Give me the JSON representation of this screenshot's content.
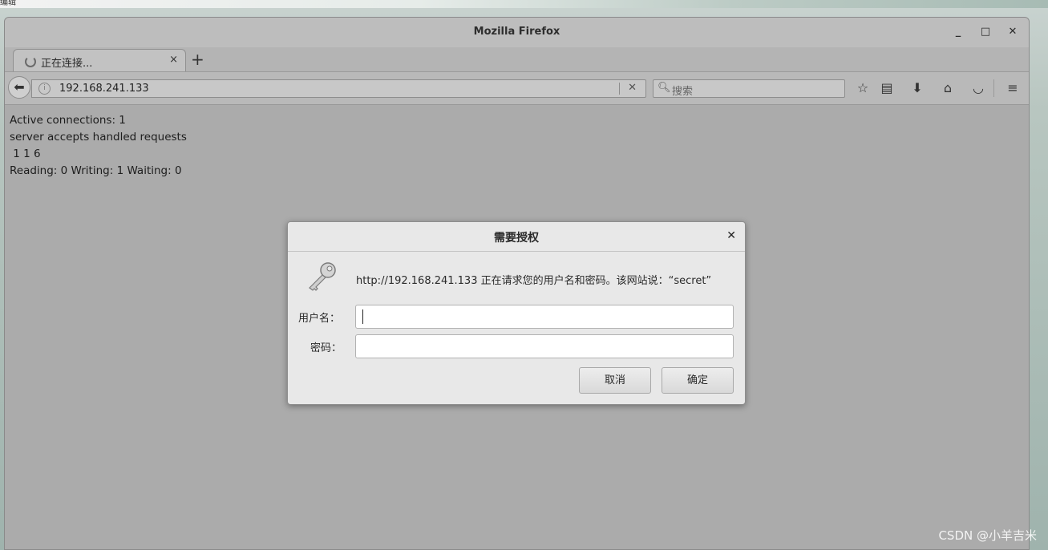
{
  "desktop": {
    "top_text": "编辑"
  },
  "window": {
    "title": "Mozilla Firefox",
    "minimize_icon": "minimize-icon",
    "maximize_icon": "maximize-icon",
    "close_icon": "close-icon"
  },
  "tab": {
    "label": "正在连接...",
    "close": "×",
    "new_tab": "+"
  },
  "navbar": {
    "url": "192.168.241.133",
    "search_placeholder": "搜索"
  },
  "page": {
    "lines": [
      "Active connections: 1",
      "server accepts handled requests",
      " 1 1 6",
      "Reading: 0 Writing: 1 Waiting: 0"
    ]
  },
  "dialog": {
    "title": "需要授权",
    "message": "http://192.168.241.133 正在请求您的用户名和密码。该网站说：“secret”",
    "username_label": "用户名：",
    "password_label": "密码：",
    "username_value": "",
    "password_value": "",
    "cancel_label": "取消",
    "ok_label": "确定"
  },
  "watermark": "CSDN @小羊吉米"
}
